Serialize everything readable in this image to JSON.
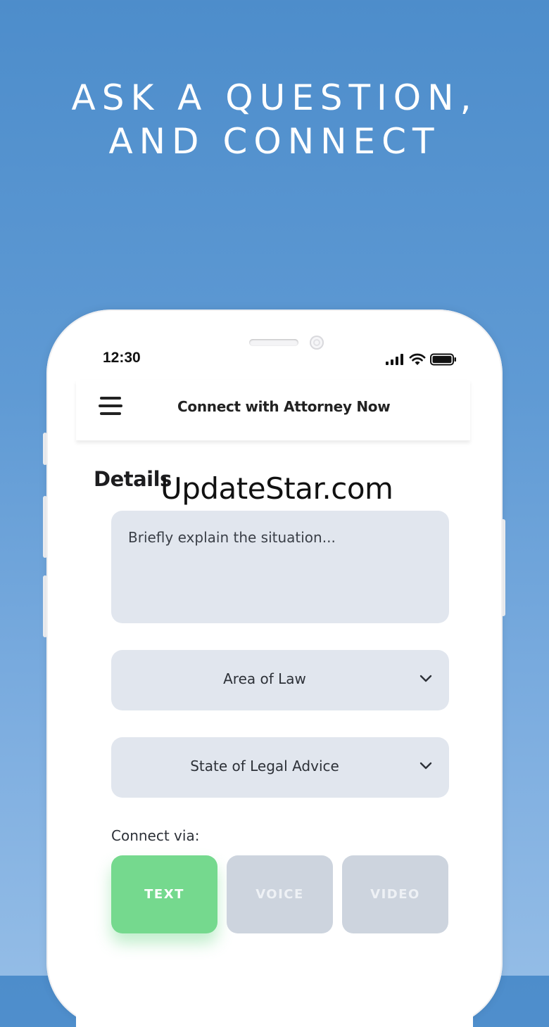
{
  "headline": {
    "line1": "ASK A QUESTION,",
    "line2": "AND CONNECT"
  },
  "status_bar": {
    "time": "12:30"
  },
  "nav": {
    "title": "Connect with Attorney Now"
  },
  "form": {
    "heading": "Details",
    "situation_placeholder": "Briefly explain the situation...",
    "area_of_law": "Area of Law",
    "state_of_legal_advice": "State of Legal Advice",
    "connect_via_label": "Connect via:",
    "modes": [
      {
        "label": "TEXT",
        "selected": true
      },
      {
        "label": "VOICE",
        "selected": false
      },
      {
        "label": "VIDEO",
        "selected": false
      }
    ]
  },
  "watermark": "UpdateStar.com",
  "colors": {
    "background_top": "#4d8dcb",
    "background_bottom": "#93bce6",
    "field_bg": "#e1e6ee",
    "selected_mode": "#75d98e",
    "unselected_mode": "#cdd4de"
  }
}
